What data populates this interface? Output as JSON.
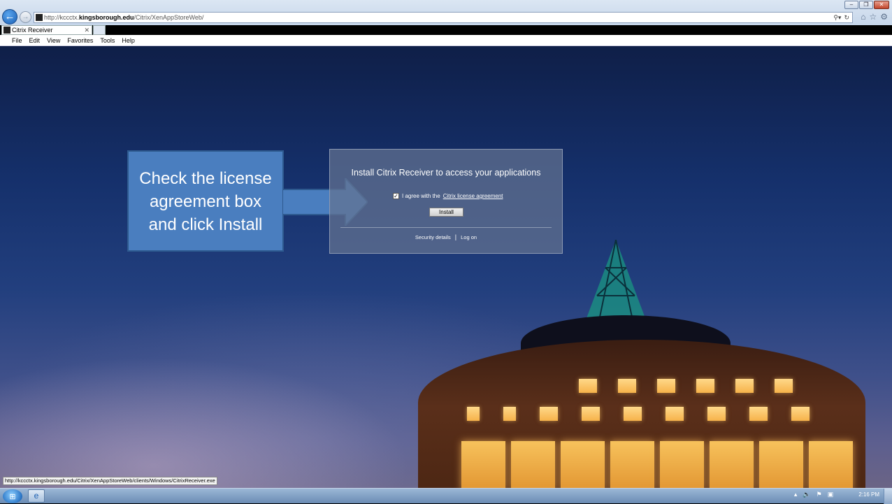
{
  "browser": {
    "address_prefix": "http://kccctx.",
    "address_domain": "kingsborough.edu",
    "address_path": "/Citrix/XenAppStoreWeb/",
    "tab_title": "Citrix Receiver",
    "menu": [
      "File",
      "Edit",
      "View",
      "Favorites",
      "Tools",
      "Help"
    ],
    "status_url": "http://kccctx.kingsborough.edu/Citrix/XenAppStoreWeb/clients/Windows/CitrixReceiver.exe"
  },
  "callout": {
    "lines": [
      "Check the license",
      "agreement box",
      "and click Install"
    ]
  },
  "panel": {
    "title": "Install Citrix Receiver to access your applications",
    "agree_text": "I agree with the",
    "agree_link": "Citrix license agreement",
    "agree_checked": true,
    "install_label": "Install",
    "security_details": "Security details",
    "separator": "|",
    "log_on": "Log on"
  },
  "taskbar": {
    "clock": "2:16 PM"
  },
  "colors": {
    "callout_fill": "#4a7ebf",
    "panel_fill": "#64738f"
  }
}
